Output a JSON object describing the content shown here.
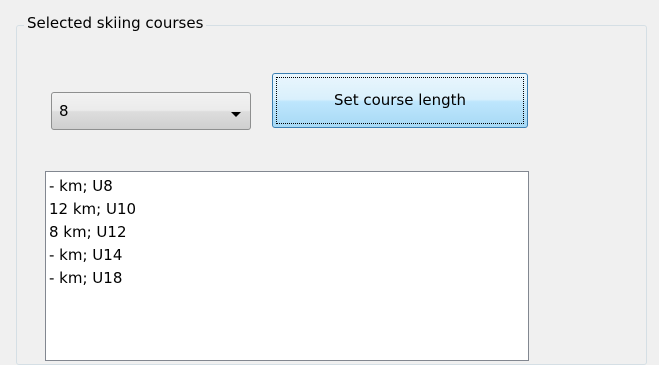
{
  "group": {
    "title": "Selected skiing courses"
  },
  "course_length_select": {
    "value": "8",
    "icon": "chevron-down-icon"
  },
  "set_length_button": {
    "label": "Set course length"
  },
  "courses_list": {
    "items": [
      "- km; U8",
      "12 km; U10",
      "8 km; U12",
      "- km; U14",
      "- km; U18"
    ]
  },
  "colors": {
    "window_bg": "#f0f0f0",
    "button_border": "#3c7fb1",
    "button_bg": "#d9f0fc",
    "list_bg": "#ffffff"
  }
}
